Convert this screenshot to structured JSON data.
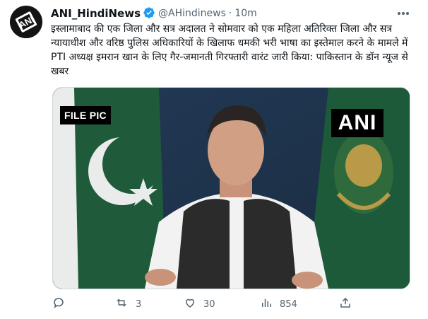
{
  "tweet": {
    "display_name": "ANI_HindiNews",
    "handle": "@AHindinews",
    "separator": "·",
    "time": "10m",
    "avatar_logo_text": "ANI",
    "text": "इस्लामाबाद की एक जिला और सत्र अदालत ने सोमवार को एक महिला अतिरिक्त जिला और सत्र न्यायाधीश और वरिष्ठ पुलिस अधिकारियों के खिलाफ धमकी भरी भाषा का इस्तेमाल करने के मामले में PTI अध्यक्ष इमरान खान के लिए गैर-जमानती गिरफ्तारी वारंट जारी किया: पाकिस्तान के डॉन न्यूज से खबर",
    "media": {
      "overlay_label": "FILE PIC",
      "watermark": "ANI"
    },
    "actions": {
      "reply_count": "",
      "retweet_count": "3",
      "like_count": "30",
      "views_count": "854"
    }
  },
  "icons": {
    "avatar": "ani-logo-icon",
    "verified": "verified-badge-icon",
    "more": "more-dots-icon",
    "reply": "reply-icon",
    "retweet": "retweet-icon",
    "like": "heart-icon",
    "views": "views-chart-icon",
    "share": "share-icon"
  },
  "colors": {
    "text_primary": "#0f1419",
    "text_secondary": "#536471",
    "verified_blue": "#1d9bf0",
    "border": "#cfd9de"
  }
}
